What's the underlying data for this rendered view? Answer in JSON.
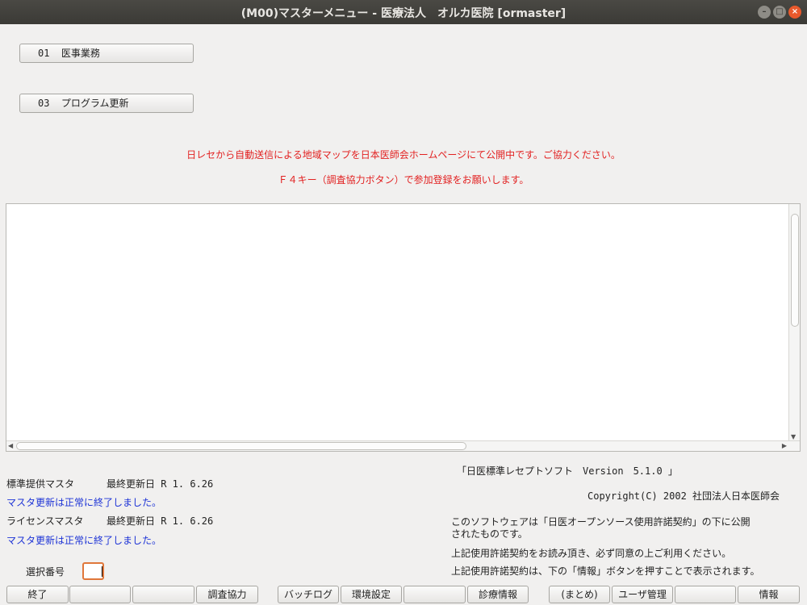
{
  "window": {
    "title": "(M00)マスターメニュー - 医療法人　オルカ医院 [ormaster]",
    "minimize_glyph": "–",
    "maximize_glyph": "□",
    "close_glyph": "×"
  },
  "menu": {
    "items": [
      {
        "code": "01",
        "label": "医事業務"
      },
      {
        "code": "03",
        "label": "プログラム更新"
      }
    ]
  },
  "notices": {
    "line1": "日レセから自動送信による地域マップを日本医師会ホームページにて公開中です。ご協力ください。",
    "line2": "Ｆ４キー（調査協力ボタン）で参加登録をお願いします。"
  },
  "status": {
    "master1_label": "標準提供マスタ",
    "master1_date": "最終更新日 R 1. 6.26",
    "master1_message": "マスタ更新は正常に終了しました。",
    "master2_label": "ライセンスマスタ",
    "master2_date": "最終更新日 R 1. 6.26",
    "master2_message": "マスタ更新は正常に終了しました。"
  },
  "about": {
    "product": "「日医標準レセプトソフト　Version　5.1.0 」",
    "copyright": "Copyright(C) 2002 社団法人日本医師会",
    "license_line1": "このソフトウェアは「日医オープンソース使用許諾契約」の下に公開",
    "license_line2": "されたものです。",
    "license_line3": "上記使用許諾契約をお読み頂き、必ず同意の上ご利用ください。",
    "license_line4": "上記使用許諾契約は、下の「情報」ボタンを押すことで表示されます。"
  },
  "selection": {
    "label": "選択番号",
    "value": ""
  },
  "function_keys": [
    {
      "label": "終了"
    },
    {
      "label": ""
    },
    {
      "label": ""
    },
    {
      "label": "調査協力"
    },
    {
      "label": "バッチログ"
    },
    {
      "label": "環境設定"
    },
    {
      "label": ""
    },
    {
      "label": "診療情報"
    },
    {
      "label": "(まとめ)"
    },
    {
      "label": "ユーザ管理"
    },
    {
      "label": ""
    },
    {
      "label": "情報"
    }
  ]
}
